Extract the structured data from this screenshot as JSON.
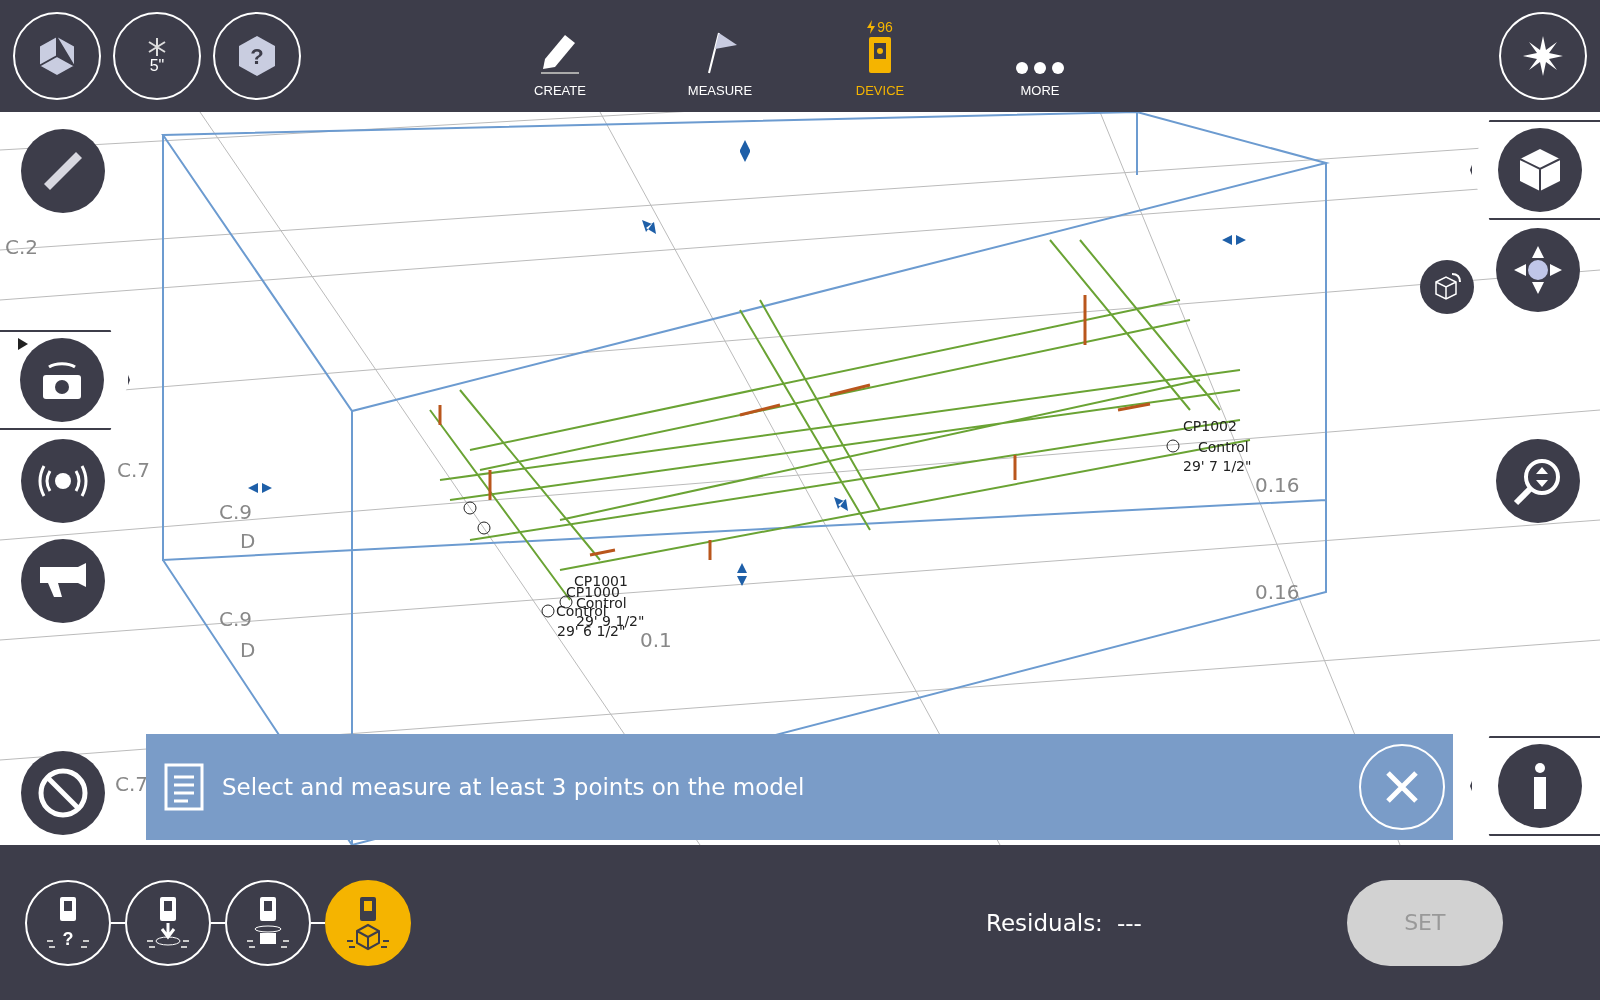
{
  "top_left": {
    "size_label": "5\"",
    "help_glyph": "?"
  },
  "nav": [
    {
      "label": "CREATE",
      "selected": false,
      "kind": "pencil"
    },
    {
      "label": "MEASURE",
      "selected": false,
      "kind": "flag"
    },
    {
      "label": "DEVICE",
      "selected": true,
      "kind": "device",
      "badge": "96"
    },
    {
      "label": "MORE",
      "selected": false,
      "kind": "dots"
    }
  ],
  "grid_labels": [
    {
      "text": "C.2"
    },
    {
      "text": "C.7"
    },
    {
      "text": "C.9"
    },
    {
      "text": "D"
    },
    {
      "text": "C.9"
    },
    {
      "text": "D"
    },
    {
      "text": "0.1"
    },
    {
      "text": "0.16"
    },
    {
      "text": "0.16"
    },
    {
      "text": "C.7"
    }
  ],
  "model_labels": [
    {
      "text": "CP1001"
    },
    {
      "text": "CP1000"
    },
    {
      "text": "Control"
    },
    {
      "text": "Control"
    },
    {
      "text": "29' 9 1/2\""
    },
    {
      "text": "29' 6 1/2\""
    },
    {
      "text": "CP1002"
    },
    {
      "text": "Control"
    },
    {
      "text": "29' 7 1/2\""
    }
  ],
  "message": {
    "text": "Select and measure at least 3 points on the model"
  },
  "steps": [
    {
      "kind": "question",
      "selected": false,
      "glyph": "?"
    },
    {
      "kind": "down",
      "selected": false
    },
    {
      "kind": "camera",
      "selected": false
    },
    {
      "kind": "cube",
      "selected": true
    }
  ],
  "residuals": {
    "label": "Residuals:",
    "value": "---"
  },
  "set_button": {
    "label": "SET",
    "disabled": true
  }
}
